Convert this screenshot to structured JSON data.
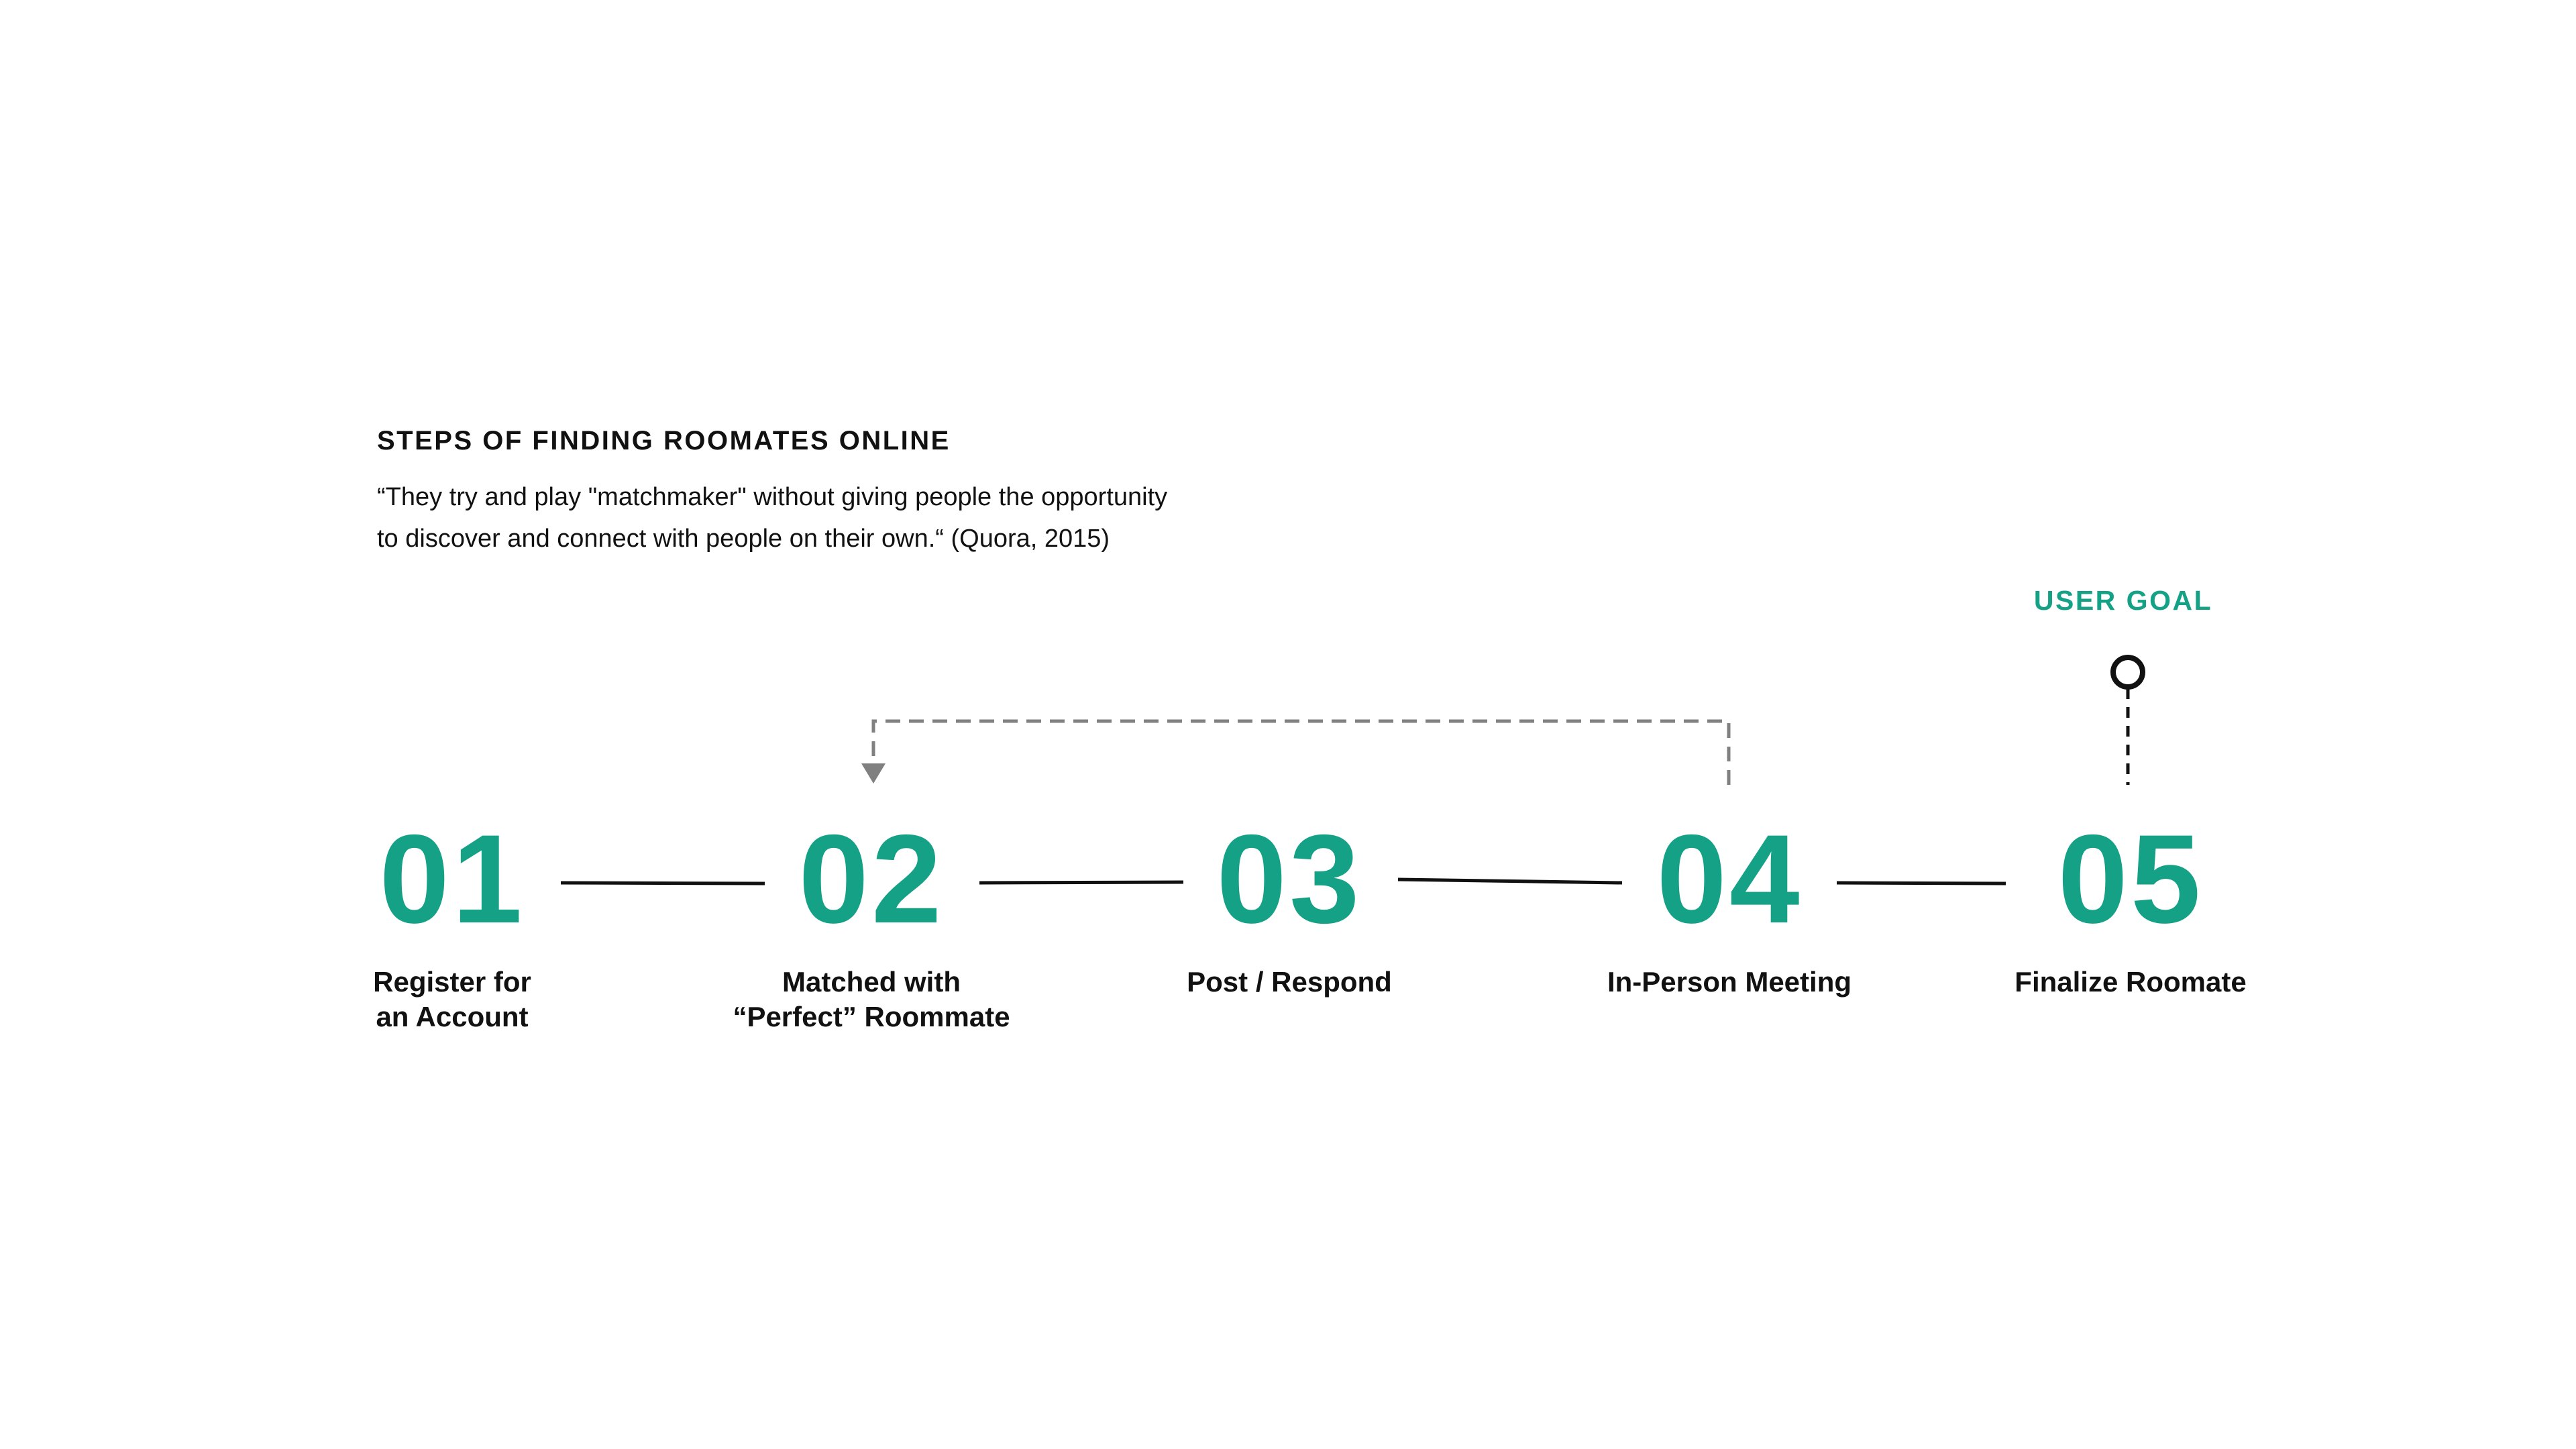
{
  "header": {
    "title": "STEPS OF FINDING ROOMATES ONLINE",
    "quote_lines": [
      "“They try and play \"matchmaker\" without giving people the opportunity",
      "to discover and connect with people on their own.“ (Quora, 2015)"
    ]
  },
  "user_goal": {
    "label": "USER GOAL"
  },
  "steps": [
    {
      "number": "01",
      "label_lines": [
        "Register for",
        "an Account"
      ]
    },
    {
      "number": "02",
      "label_lines": [
        "Matched with",
        "“Perfect” Roommate"
      ]
    },
    {
      "number": "03",
      "label_lines": [
        "Post / Respond"
      ]
    },
    {
      "number": "04",
      "label_lines": [
        "In-Person Meeting"
      ]
    },
    {
      "number": "05",
      "label_lines": [
        "Finalize Roomate"
      ]
    }
  ],
  "loop": {
    "from_step": "04",
    "to_step": "02"
  },
  "colors": {
    "accent": "#14a186",
    "text": "#111111",
    "connector": "#111111",
    "loop_arrow": "#808080"
  }
}
